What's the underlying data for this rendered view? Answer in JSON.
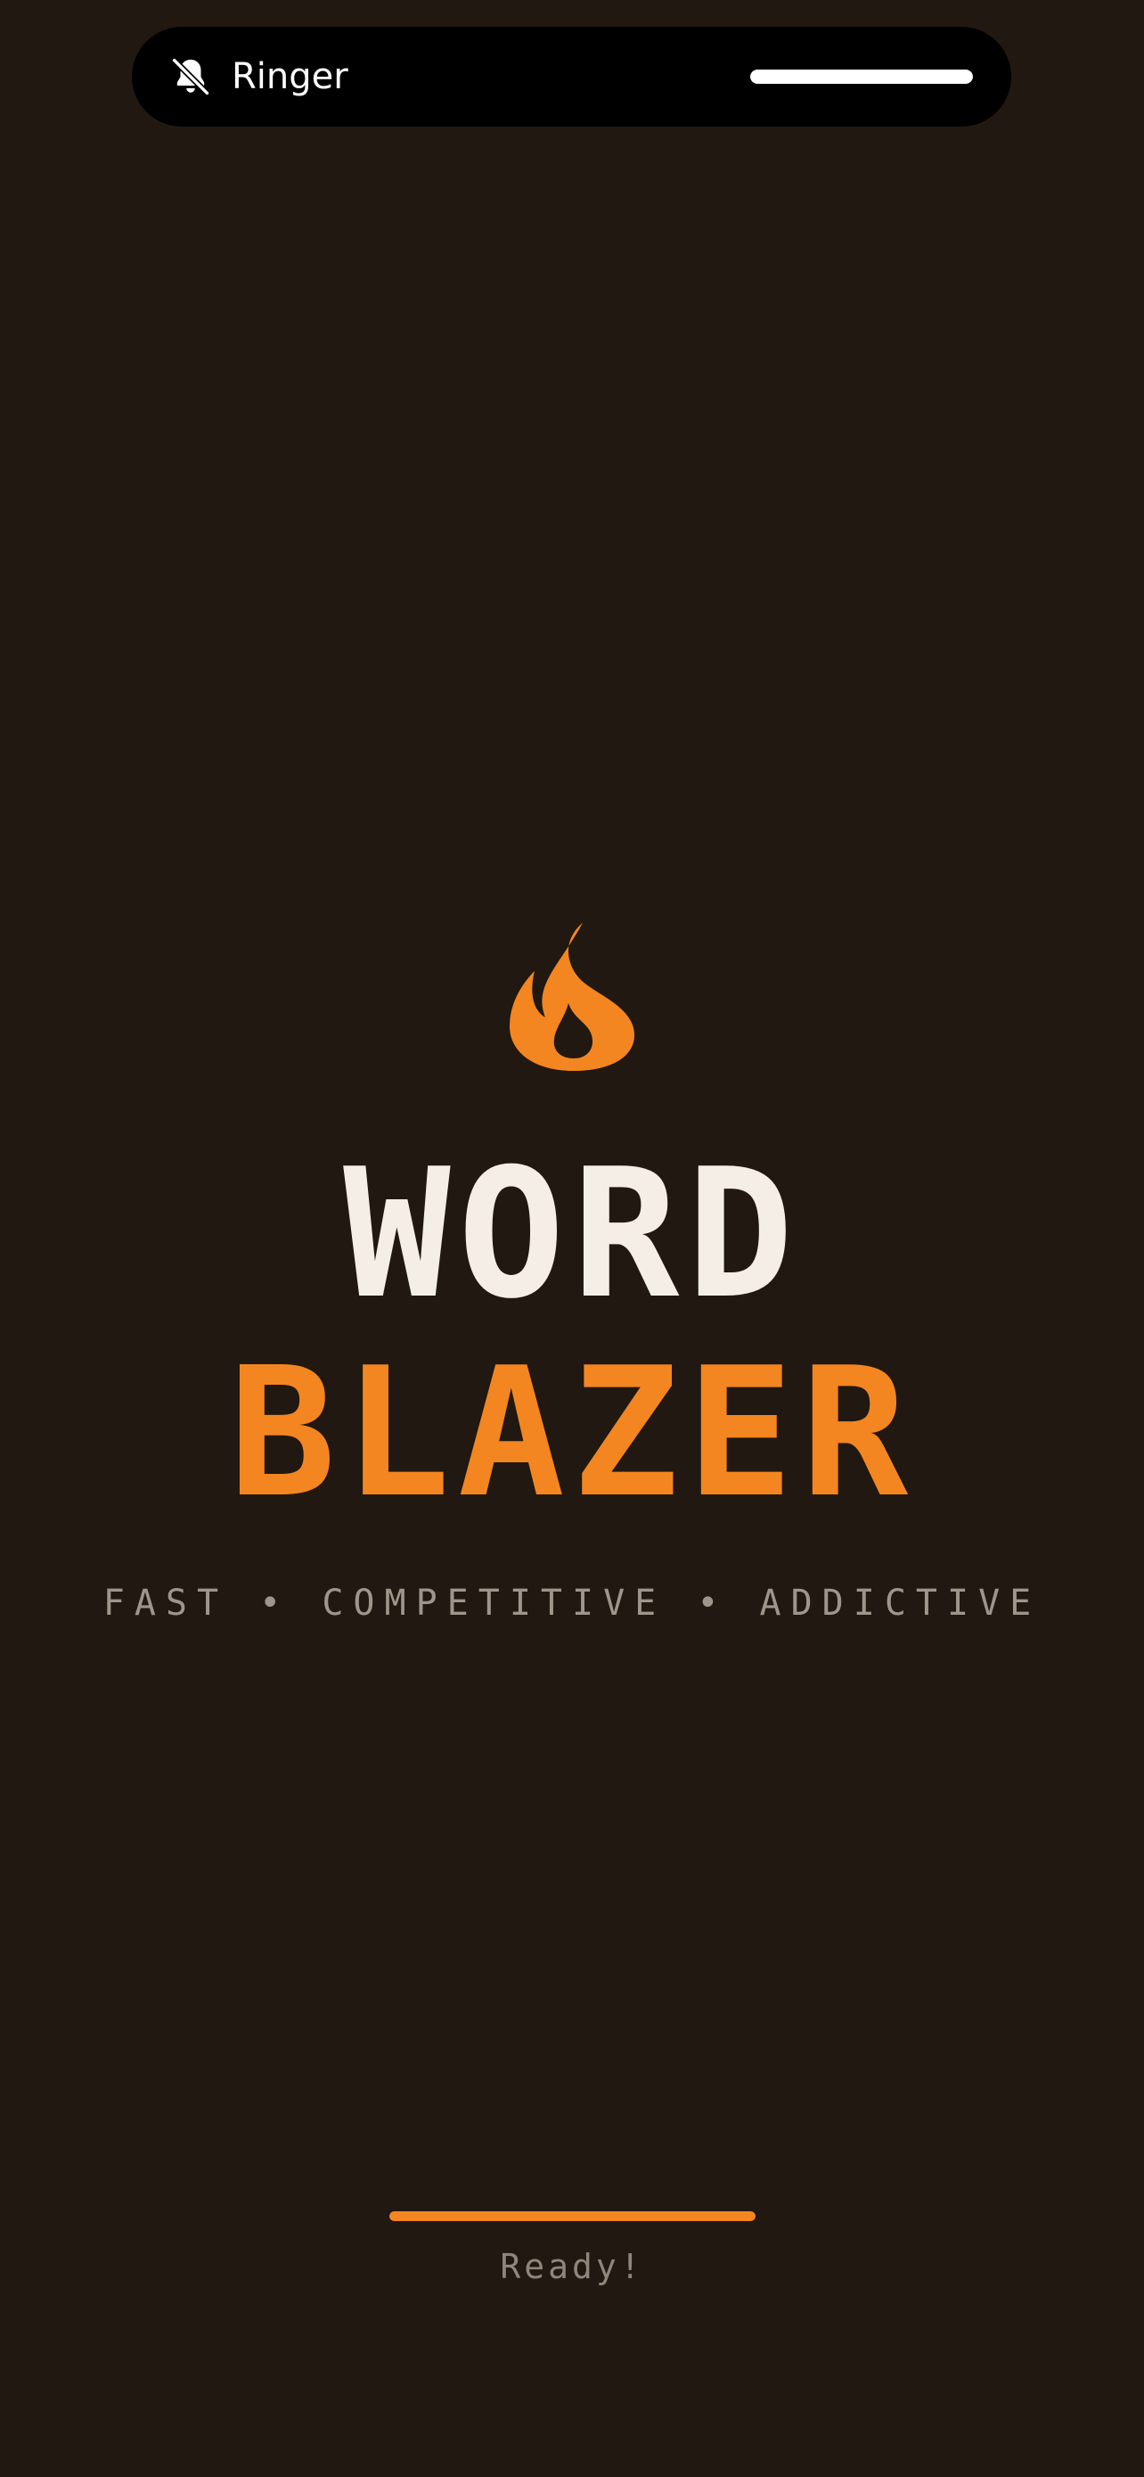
{
  "colors": {
    "background": "#211811",
    "accent": "#f38620",
    "title_primary": "#f4eee7",
    "tagline": "#9f958b",
    "status": "#8f857b"
  },
  "ringer_banner": {
    "icon": "bell-slash-icon",
    "label": "Ringer",
    "volume_level": 1.0
  },
  "splash": {
    "logo_icon": "flame-icon",
    "title_line1": "WORD",
    "title_line2": "BLAZER",
    "tagline": "FAST • COMPETITIVE • ADDICTIVE"
  },
  "loading": {
    "progress": 1.0,
    "status_text": "Ready!"
  }
}
